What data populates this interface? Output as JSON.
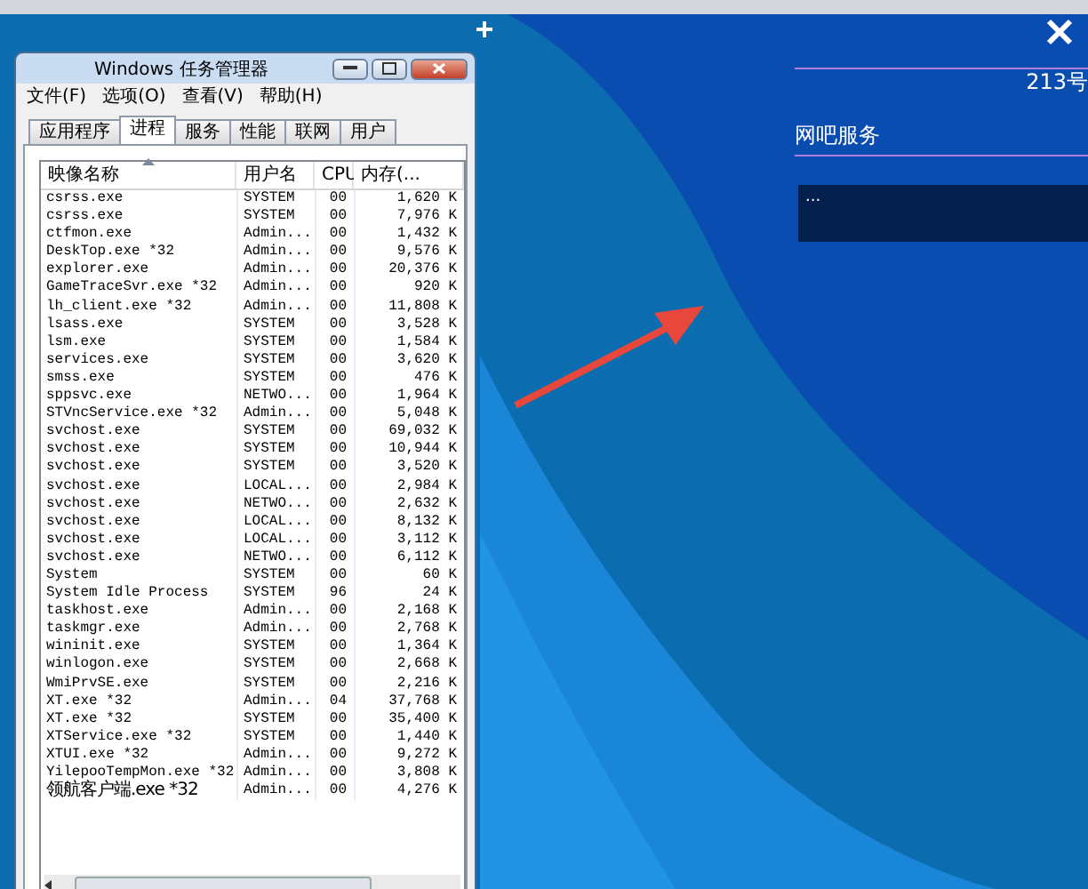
{
  "task_manager": {
    "title": "Windows 任务管理器",
    "menu": [
      "文件(F)",
      "选项(O)",
      "查看(V)",
      "帮助(H)"
    ],
    "tabs": [
      {
        "label": "应用程序",
        "selected": false
      },
      {
        "label": "进程",
        "selected": true
      },
      {
        "label": "服务",
        "selected": false
      },
      {
        "label": "性能",
        "selected": false
      },
      {
        "label": "联网",
        "selected": false
      },
      {
        "label": "用户",
        "selected": false
      }
    ],
    "columns": [
      "映像名称",
      "用户名",
      "CPU",
      "内存(..."
    ],
    "rows": [
      [
        "csrss.exe",
        "SYSTEM",
        "00",
        "1,620 K"
      ],
      [
        "csrss.exe",
        "SYSTEM",
        "00",
        "7,976 K"
      ],
      [
        "ctfmon.exe",
        "Admin...",
        "00",
        "1,432 K"
      ],
      [
        "DeskTop.exe *32",
        "Admin...",
        "00",
        "9,576 K"
      ],
      [
        "explorer.exe",
        "Admin...",
        "00",
        "20,376 K"
      ],
      [
        "GameTraceSvr.exe *32",
        "Admin...",
        "00",
        "920 K"
      ],
      [
        "lh_client.exe *32",
        "Admin...",
        "00",
        "11,808 K"
      ],
      [
        "lsass.exe",
        "SYSTEM",
        "00",
        "3,528 K"
      ],
      [
        "lsm.exe",
        "SYSTEM",
        "00",
        "1,584 K"
      ],
      [
        "services.exe",
        "SYSTEM",
        "00",
        "3,620 K"
      ],
      [
        "smss.exe",
        "SYSTEM",
        "00",
        "476 K"
      ],
      [
        "sppsvc.exe",
        "NETWO...",
        "00",
        "1,964 K"
      ],
      [
        "STVncService.exe *32",
        "Admin...",
        "00",
        "5,048 K"
      ],
      [
        "svchost.exe",
        "SYSTEM",
        "00",
        "69,032 K"
      ],
      [
        "svchost.exe",
        "SYSTEM",
        "00",
        "10,944 K"
      ],
      [
        "svchost.exe",
        "SYSTEM",
        "00",
        "3,520 K"
      ],
      [
        "svchost.exe",
        "LOCAL...",
        "00",
        "2,984 K"
      ],
      [
        "svchost.exe",
        "NETWO...",
        "00",
        "2,632 K"
      ],
      [
        "svchost.exe",
        "LOCAL...",
        "00",
        "8,132 K"
      ],
      [
        "svchost.exe",
        "LOCAL...",
        "00",
        "3,112 K"
      ],
      [
        "svchost.exe",
        "NETWO...",
        "00",
        "6,112 K"
      ],
      [
        "System",
        "SYSTEM",
        "00",
        "60 K"
      ],
      [
        "System Idle Process",
        "SYSTEM",
        "96",
        "24 K"
      ],
      [
        "taskhost.exe",
        "Admin...",
        "00",
        "2,168 K"
      ],
      [
        "taskmgr.exe",
        "Admin...",
        "00",
        "2,768 K"
      ],
      [
        "wininit.exe",
        "SYSTEM",
        "00",
        "1,364 K"
      ],
      [
        "winlogon.exe",
        "SYSTEM",
        "00",
        "2,668 K"
      ],
      [
        "WmiPrvSE.exe",
        "SYSTEM",
        "00",
        "2,216 K"
      ],
      [
        "XT.exe *32",
        "Admin...",
        "04",
        "37,768 K"
      ],
      [
        "XT.exe *32",
        "SYSTEM",
        "00",
        "35,400 K"
      ],
      [
        "XTService.exe *32",
        "SYSTEM",
        "00",
        "1,440 K"
      ],
      [
        "XTUI.exe *32",
        "Admin...",
        "00",
        "9,272 K"
      ],
      [
        "YilepooTempMon.exe *32",
        "Admin...",
        "00",
        "3,808 K"
      ],
      [
        "领航客户端.exe *32",
        "Admin...",
        "00",
        "4,276 K"
      ]
    ]
  },
  "side_panel": {
    "machine": "213号",
    "service": "网吧服务",
    "info": "..."
  }
}
